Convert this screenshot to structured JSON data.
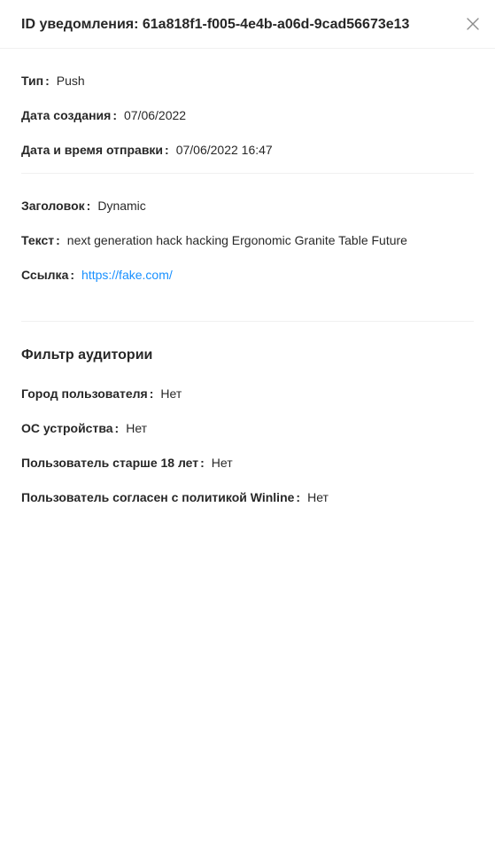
{
  "drawer": {
    "title": "ID уведомления: 61a818f1-f005-4e4b-a06d-9cad56673e13",
    "close_icon": "close-icon"
  },
  "info": {
    "type_label": "Тип",
    "type_value": "Push",
    "created_label": "Дата создания",
    "created_value": "07/06/2022",
    "sent_label": "Дата и время отправки",
    "sent_value": "07/06/2022 16:47"
  },
  "content": {
    "title_label": "Заголовок",
    "title_value": "Dynamic",
    "text_label": "Текст",
    "text_value": "next generation hack hacking Ergonomic Granite Table Future",
    "link_label": "Ссылка",
    "link_value": "https://fake.com/"
  },
  "audience": {
    "heading": "Фильтр аудитории",
    "city_label": "Город пользователя",
    "city_value": "Нет",
    "os_label": "ОС устройства",
    "os_value": "Нет",
    "age_label": "Пользователь старше 18 лет",
    "age_value": "Нет",
    "policy_label": "Пользователь согласен с политикой Winline",
    "policy_value": "Нет"
  },
  "colors": {
    "link": "#1890ff",
    "divider": "#f0f0f0",
    "text": "#262626"
  }
}
